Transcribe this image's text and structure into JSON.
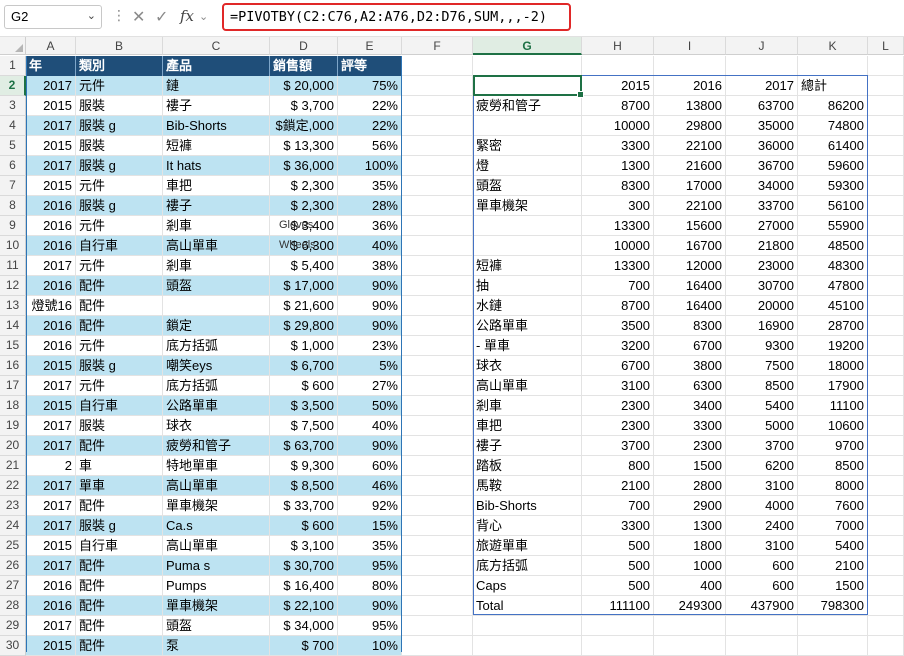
{
  "formula_bar": {
    "name_box": "G2",
    "formula": "=PIVOTBY(C2:C76,A2:A76,D2:D76,SUM,,,-2)"
  },
  "columns": [
    "A",
    "B",
    "C",
    "D",
    "E",
    "F",
    "G",
    "H",
    "I",
    "J",
    "K",
    "L"
  ],
  "rows": [
    "1",
    "2",
    "3",
    "4",
    "5",
    "6",
    "7",
    "8",
    "9",
    "10",
    "11",
    "12",
    "13",
    "14",
    "15",
    "16",
    "17",
    "18",
    "19",
    "20",
    "21",
    "22",
    "23",
    "24",
    "25",
    "26",
    "27",
    "28",
    "29",
    "30"
  ],
  "table": {
    "headers": [
      "年",
      "類別",
      "產品",
      "銷售額",
      "評等"
    ],
    "rows": [
      [
        "2017",
        "元件",
        "鏈",
        "$ 20,000",
        "75%"
      ],
      [
        "2015",
        "服裝",
        "褸子",
        "$   3,700",
        "22%"
      ],
      [
        "2017",
        "服裝      g",
        "Bib-Shorts",
        "$鎖定,000",
        "22%"
      ],
      [
        "2015",
        "服裝",
        "短褲",
        "$ 13,300",
        "56%"
      ],
      [
        "2017",
        "服裝      g",
        "It hats",
        "$ 36,000",
        "100%"
      ],
      [
        "2015",
        "元件",
        "車把",
        "$   2,300",
        "35%"
      ],
      [
        "2016",
        "服裝      g",
        "褸子",
        "$   2,300",
        "28%"
      ],
      [
        "2016",
        "元件",
        "剎車",
        "$   3,400",
        "36%"
      ],
      [
        "2016",
        "自行車",
        "高山單車",
        "$   6,300",
        "40%"
      ],
      [
        "2017",
        "元件",
        "剎車",
        "$   5,400",
        "38%"
      ],
      [
        "2016",
        "配件",
        "頭盔",
        "$ 17,000",
        "90%"
      ],
      [
        "燈號16",
        "配件",
        "",
        "$ 21,600",
        "90%"
      ],
      [
        "2016",
        "配件",
        "鎖定",
        "$ 29,800",
        "90%"
      ],
      [
        "2016",
        "元件",
        "底方括弧",
        "$   1,000",
        "23%"
      ],
      [
        "2015",
        "服裝      g",
        "嘲笑eys",
        "$   6,700",
        "5%"
      ],
      [
        "2017",
        "元件",
        "底方括弧",
        "$      600",
        "27%"
      ],
      [
        "2015",
        "自行車",
        "公路單車",
        "$   3,500",
        "50%"
      ],
      [
        "2017",
        "服裝",
        "球衣",
        "$   7,500",
        "40%"
      ],
      [
        "2017",
        "配件",
        "疲勞和管子",
        "$ 63,700",
        "90%"
      ],
      [
        "2",
        "車",
        "特地單車",
        "$   9,300",
        "60%"
      ],
      [
        "2017",
        "單車",
        "高山單車",
        "$   8,500",
        "46%"
      ],
      [
        "2017",
        "配件",
        "單車機架",
        "$ 33,700",
        "92%"
      ],
      [
        "2017",
        "服裝      g",
        "Ca.s",
        "$      600",
        "15%"
      ],
      [
        "2015",
        "自行車",
        "高山單車",
        "$   3,100",
        "35%"
      ],
      [
        "2017",
        "配件",
        "Puma s",
        "$ 30,700",
        "95%"
      ],
      [
        "2016",
        "配件",
        "Pumps",
        "$ 16,400",
        "80%"
      ],
      [
        "2016",
        "配件",
        "單車機架",
        "$ 22,100",
        "90%"
      ],
      [
        "2017",
        "配件",
        "頭盔",
        "$ 34,000",
        "95%"
      ],
      [
        "2015",
        "配件",
        "泵",
        "$      700",
        "10%"
      ]
    ],
    "overlays": [
      "Gloves",
      "Wheels"
    ]
  },
  "pivot": {
    "header": [
      "",
      "2015",
      "2016",
      "2017",
      "總計"
    ],
    "rows": [
      [
        "疲勞和管子",
        "8700",
        "13800",
        "63700",
        "86200"
      ],
      [
        "",
        "10000",
        "29800",
        "35000",
        "74800"
      ],
      [
        "緊密",
        "3300",
        "22100",
        "36000",
        "61400"
      ],
      [
        "燈",
        "1300",
        "21600",
        "36700",
        "59600"
      ],
      [
        "頭盔",
        "8300",
        "17000",
        "34000",
        "59300"
      ],
      [
        "單車機架",
        "300",
        "22100",
        "33700",
        "56100"
      ],
      [
        "",
        "13300",
        "15600",
        "27000",
        "55900"
      ],
      [
        "",
        "10000",
        "16700",
        "21800",
        "48500"
      ],
      [
        "短褲",
        "13300",
        "12000",
        "23000",
        "48300"
      ],
      [
        "抽",
        "700",
        "16400",
        "30700",
        "47800"
      ],
      [
        "水鏈",
        "8700",
        "16400",
        "20000",
        "45100"
      ],
      [
        "公路單車",
        "3500",
        "8300",
        "16900",
        "28700"
      ],
      [
        "- 單車",
        "3200",
        "6700",
        "9300",
        "19200"
      ],
      [
        "球衣",
        "6700",
        "3800",
        "7500",
        "18000"
      ],
      [
        "高山單車",
        "3100",
        "6300",
        "8500",
        "17900"
      ],
      [
        "剎車",
        "2300",
        "3400",
        "5400",
        "11100"
      ],
      [
        "車把",
        "2300",
        "3300",
        "5000",
        "10600"
      ],
      [
        "褸子",
        "3700",
        "2300",
        "3700",
        "9700"
      ],
      [
        "踏板",
        "800",
        "1500",
        "6200",
        "8500"
      ],
      [
        "馬鞍",
        "2100",
        "2800",
        "3100",
        "8000"
      ],
      [
        "Bib-Shorts",
        "700",
        "2900",
        "4000",
        "7600"
      ],
      [
        "背心",
        "3300",
        "1300",
        "2400",
        "7000"
      ],
      [
        "旅遊單車",
        "500",
        "1800",
        "3100",
        "5400"
      ],
      [
        "底方括弧",
        "500",
        "1000",
        "600",
        "2100"
      ],
      [
        "Caps",
        "500",
        "400",
        "600",
        "1500"
      ],
      [
        "Total",
        "111100",
        "249300",
        "437900",
        "798300"
      ]
    ]
  },
  "colors": {
    "table_header": "#1f4e79",
    "band": "#bde3f2",
    "formula_highlight": "#e02828",
    "selection": "#1e7145",
    "pivot_border": "#4472c4"
  }
}
